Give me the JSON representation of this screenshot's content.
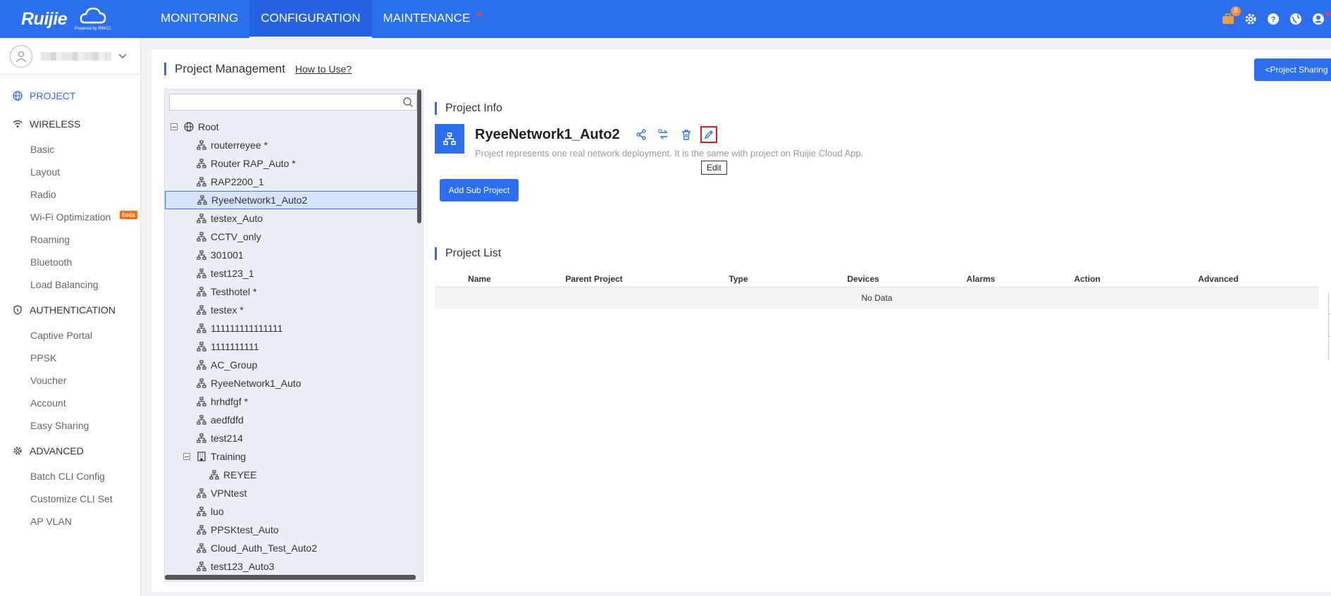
{
  "header": {
    "logo_text": "Ruijie",
    "logo_sub": "Powered by RWCC",
    "nav": [
      {
        "label": "MONITORING"
      },
      {
        "label": "CONFIGURATION"
      },
      {
        "label": "MAINTENANCE"
      }
    ],
    "notification_count": "8",
    "icons": [
      "briefcase-icon",
      "gear-icon",
      "help-icon",
      "globe-icon",
      "user-icon"
    ],
    "accent_color": "#2b6ef0"
  },
  "sidebar": {
    "sections": [
      {
        "label": "PROJECT",
        "icon": "globe-icon",
        "items": []
      },
      {
        "label": "WIRELESS",
        "icon": "wifi-icon",
        "items": [
          "Basic",
          "Layout",
          "Radio",
          "Wi-Fi Optimization",
          "Roaming",
          "Bluetooth",
          "Load Balancing"
        ]
      },
      {
        "label": "AUTHENTICATION",
        "icon": "shield-icon",
        "items": [
          "Captive Portal",
          "PPSK",
          "Voucher",
          "Account",
          "Easy Sharing"
        ]
      },
      {
        "label": "ADVANCED",
        "icon": "gear-icon",
        "items": [
          "Batch CLI Config",
          "Customize CLI Set",
          "AP VLAN"
        ]
      }
    ],
    "beta_label": "beta"
  },
  "main": {
    "title": "Project Management",
    "how_to": "How to Use?",
    "share_button": "<Project Sharing",
    "search_placeholder": "",
    "tree": {
      "root": "Root",
      "items": [
        "routerreyee *",
        "Router RAP_Auto *",
        "RAP2200_1",
        "RyeeNetwork1_Auto2",
        "testex_Auto",
        "CCTV_only",
        "301001",
        "test123_1",
        "Testhotel *",
        "testex *",
        "111111111111111",
        "1111111111",
        "AC_Group",
        "RyeeNetwork1_Auto",
        "hrhdfgf *",
        "aedfdfd",
        "test214"
      ],
      "group": "Training",
      "group_child": "REYEE",
      "items_after": [
        "VPNtest",
        "luo",
        "PPSKtest_Auto",
        "Cloud_Auth_Test_Auto2",
        "test123_Auto3"
      ],
      "selected": "RyeeNetwork1_Auto2"
    },
    "project_info": {
      "section_title": "Project Info",
      "name": "RyeeNetwork1_Auto2",
      "description": "Project represents one real network deployment. It is the same with project on Ruijie Cloud App.",
      "tooltip": "Edit",
      "add_sub": "Add Sub Project"
    },
    "project_list": {
      "section_title": "Project List",
      "columns": [
        "Name",
        "Parent Project",
        "Type",
        "Devices",
        "Alarms",
        "Action",
        "Advanced"
      ],
      "empty": "No Data"
    }
  }
}
